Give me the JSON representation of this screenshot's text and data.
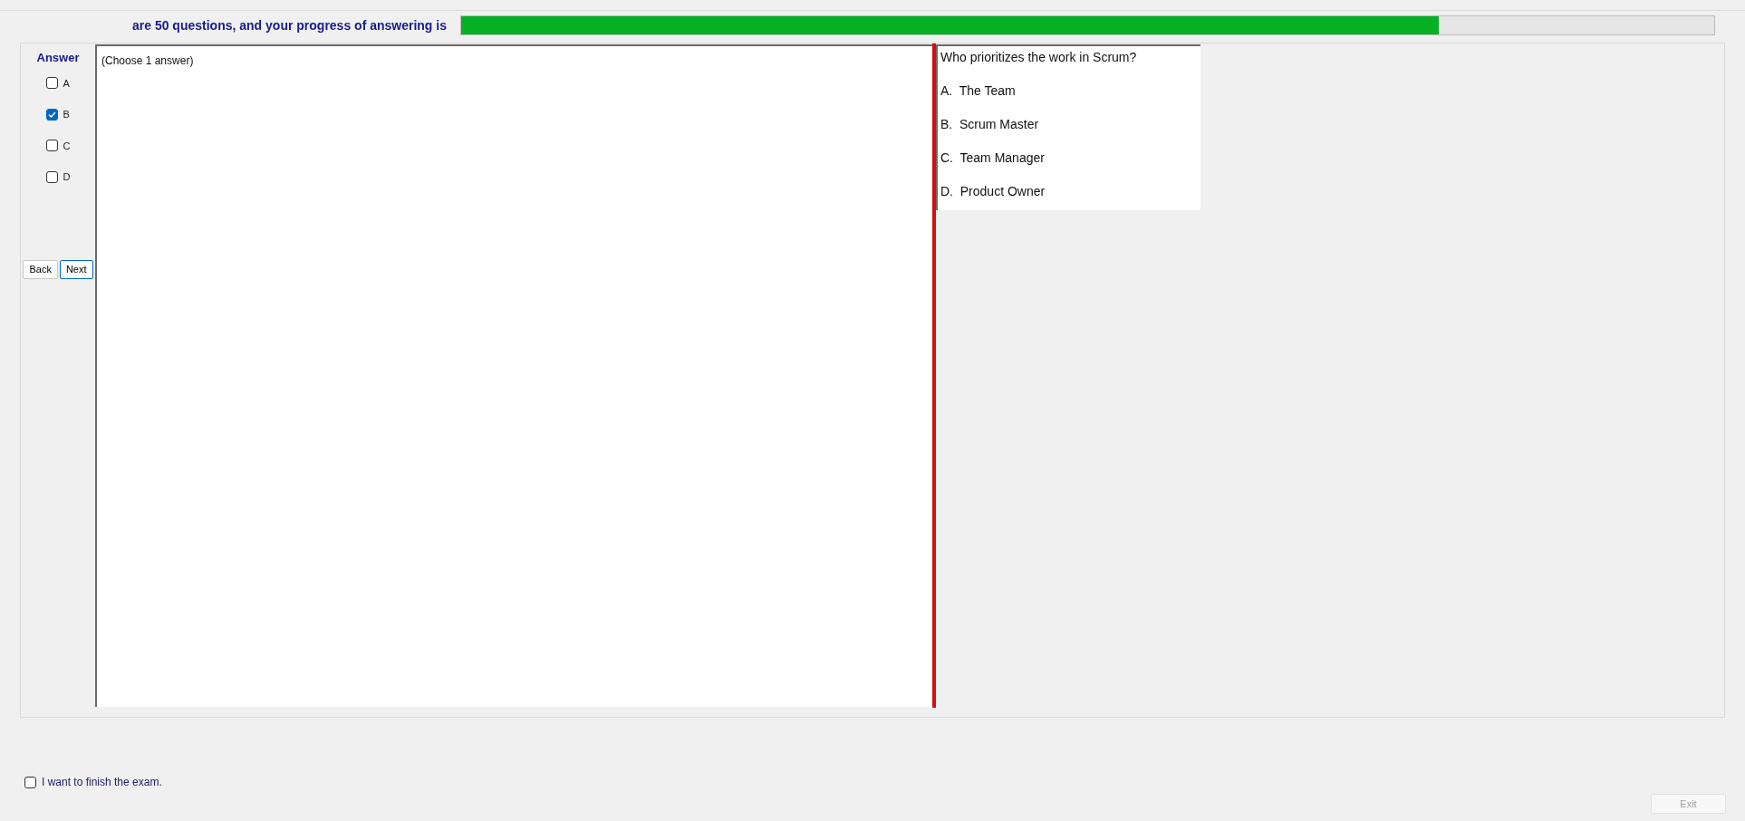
{
  "header": {
    "text": "are 50 questions, and your progress of answering is",
    "progress": {
      "level": 0.78
    }
  },
  "answer_panel": {
    "title": "Answer",
    "options": [
      {
        "label": "A",
        "checked": false
      },
      {
        "label": "B",
        "checked": true
      },
      {
        "label": "C",
        "checked": false
      },
      {
        "label": "D",
        "checked": false
      }
    ],
    "buttons": [
      {
        "label": "Back",
        "focused": false
      },
      {
        "label": "Next",
        "focused": true
      }
    ]
  },
  "answer_area": {
    "hint": "(Choose 1 answer)"
  },
  "question": {
    "text": "Who prioritizes the work in Scrum?",
    "choices": [
      "A.  The Team",
      "B.  Scrum Master",
      "C.  Team Manager",
      "D.  Product Owner"
    ]
  },
  "finish": {
    "label": "I want to finish the exam.",
    "checked": false
  },
  "exit_button": {
    "label": "Exit",
    "disabled": true
  }
}
